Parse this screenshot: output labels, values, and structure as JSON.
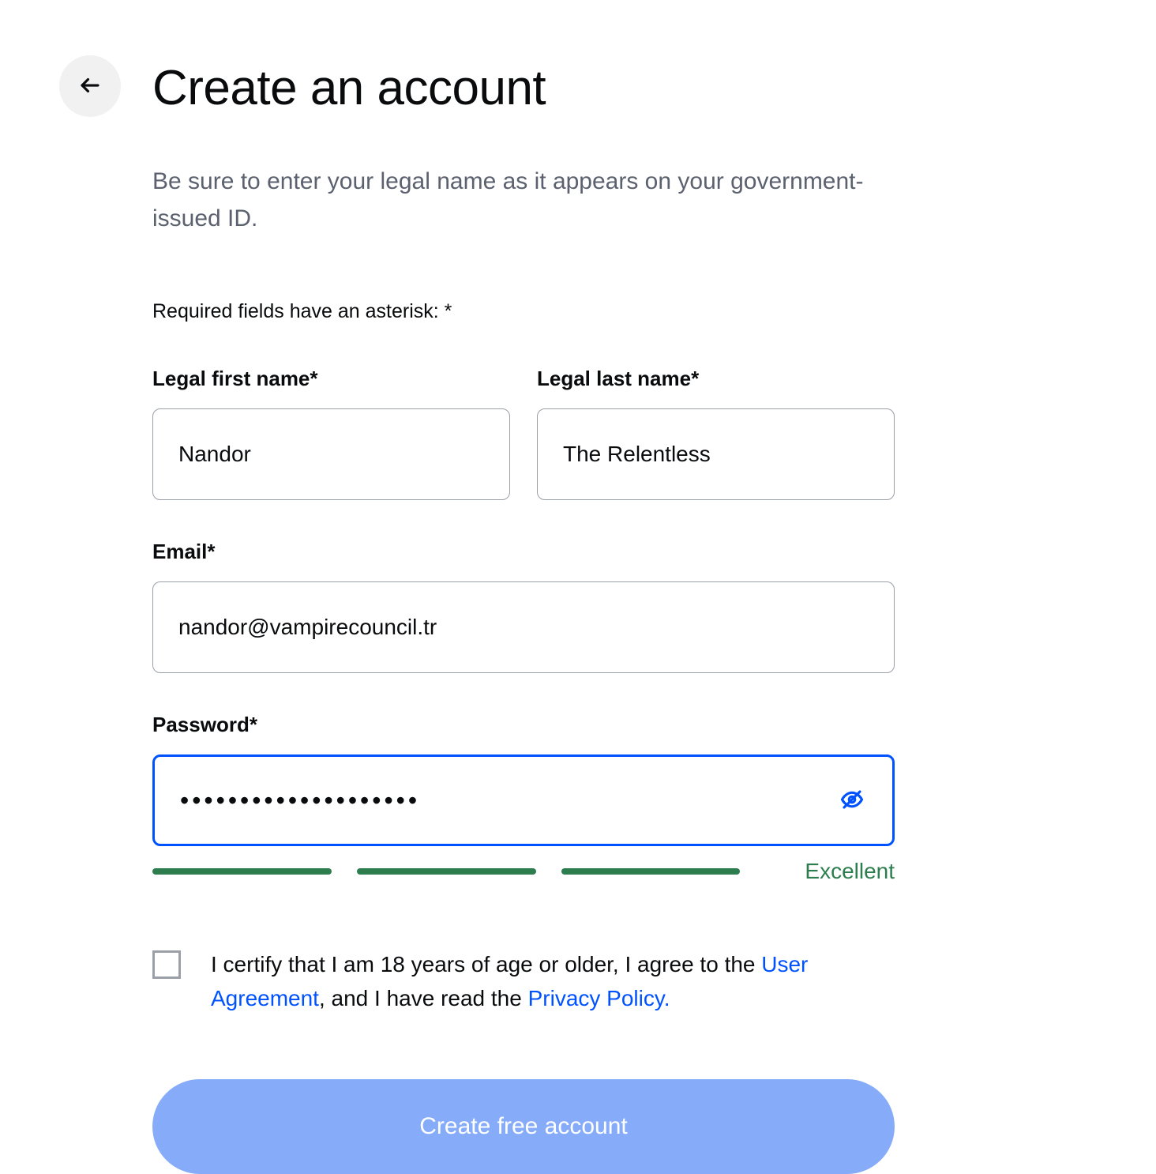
{
  "title": "Create an account",
  "subtitle": "Be sure to enter your legal name as it appears on your government-issued ID.",
  "required_note": "Required fields have an asterisk: *",
  "fields": {
    "first_name": {
      "label": "Legal first name*",
      "value": "Nandor"
    },
    "last_name": {
      "label": "Legal last name*",
      "value": "The Relentless"
    },
    "email": {
      "label": "Email*",
      "value": "nandor@vampirecouncil.tr"
    },
    "password": {
      "label": "Password*",
      "value": "••••••••••••••••••••"
    }
  },
  "strength": {
    "label": "Excellent",
    "color": "#2e7d4f"
  },
  "certify": {
    "text_1": "I certify that I am 18 years of age or older, I agree to the ",
    "link_1": "User Agreement",
    "text_2": ", and I have read the ",
    "link_2": "Privacy Policy."
  },
  "submit_label": "Create free account"
}
